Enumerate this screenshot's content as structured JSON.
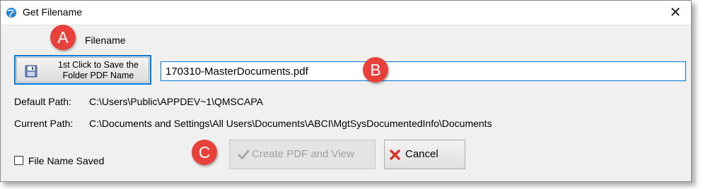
{
  "window": {
    "title": "Get Filename",
    "close_glyph": "✕"
  },
  "markers": {
    "a": "A",
    "b": "B",
    "c": "C"
  },
  "filename_section": {
    "label": "Filename",
    "save_button_line1": "1st Click to Save the",
    "save_button_line2": "Folder PDF Name",
    "input_value": "170310-MasterDocuments.pdf"
  },
  "paths": {
    "default_label": "Default Path:",
    "default_value": "C:\\Users\\Public\\APPDEV~1\\QMSCAPA",
    "current_label": "Current Path:",
    "current_value": "C:\\Documents and Settings\\All Users\\Documents\\ABCI\\MgtSysDocumentedInfo\\Documents"
  },
  "footer": {
    "checkbox_label": "File Name Saved",
    "checkbox_checked": false,
    "create_button": "Create PDF and View",
    "create_button_enabled": false,
    "cancel_button": "Cancel"
  },
  "colors": {
    "marker": "#e8413b",
    "focus_border": "#0078d7",
    "dialog_bg": "#f0f0f0",
    "cancel_icon": "#d9342b",
    "disabled_text": "#a0a0a0"
  },
  "icons": {
    "app": "app-globe-icon",
    "save": "floppy-disk-icon",
    "create": "checkmark-icon",
    "cancel": "red-x-icon"
  }
}
